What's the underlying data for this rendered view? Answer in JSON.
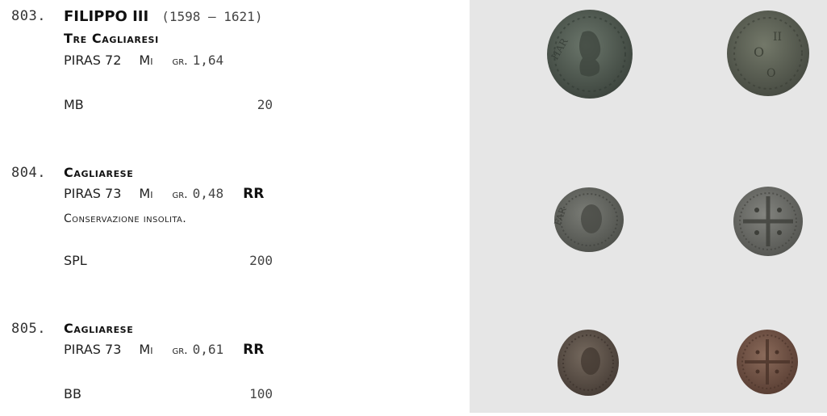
{
  "lots": [
    {
      "number": "803.",
      "ruler": "FILIPPO III",
      "dates": "(1598 – 1621)",
      "denomination": "Tre Cagliaresi",
      "reference": "PIRAS 72",
      "metal": "Mi",
      "gr_label": "gr.",
      "weight": "1,64",
      "rarity": "",
      "note": "",
      "grade": "MB",
      "price": "20",
      "coin_colors": {
        "obverse": "#4f5a50",
        "reverse": "#5a5f56"
      }
    },
    {
      "number": "804.",
      "ruler": "",
      "dates": "",
      "denomination": "Cagliarese",
      "reference": "PIRAS 73",
      "metal": "Mi",
      "gr_label": "gr.",
      "weight": "0,48",
      "rarity": "RR",
      "note": "Conservazione insolita.",
      "grade": "SPL",
      "price": "200",
      "coin_colors": {
        "obverse": "#62655f",
        "reverse": "#6a6c68"
      }
    },
    {
      "number": "805.",
      "ruler": "",
      "dates": "",
      "denomination": "Cagliarese",
      "reference": "PIRAS 73",
      "metal": "Mi",
      "gr_label": "gr.",
      "weight": "0,61",
      "rarity": "RR",
      "note": "",
      "grade": "BB",
      "price": "100",
      "coin_colors": {
        "obverse": "#5b5048",
        "reverse": "#6b4e42"
      }
    }
  ],
  "colors": {
    "photo_background": "#e6e6e6",
    "page_background": "#ffffff"
  },
  "images": [
    "coin-obverse-image",
    "coin-reverse-image"
  ]
}
